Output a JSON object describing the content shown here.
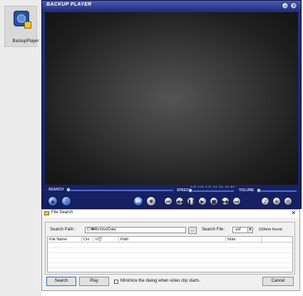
{
  "desktop": {
    "icon_label": "BackupPlayer"
  },
  "player": {
    "title": "BACKUP PLAYER",
    "minimize_glyph": "–",
    "close_glyph": "✕",
    "search_label": "SEARCH",
    "speed_label": "SPEED",
    "volume_label": "VOLUME",
    "speed_ticks": "1/8 1/4 1/2 1x 2x 4x 8x",
    "w_glyph": "W",
    "colors": {
      "frame": "#1e2b72",
      "accent": "#4f7bdc"
    },
    "icons": [
      "eject-icon",
      "search-icon",
      "web-icon",
      "snapshot-icon",
      "skip-back-icon",
      "step-back-icon",
      "pause-icon",
      "play-icon",
      "stop-icon",
      "step-forward-icon",
      "skip-forward-icon",
      "audio-icon",
      "zoom-icon",
      "settings-icon"
    ]
  },
  "dialog": {
    "title": "File Search",
    "close_glyph": "✕",
    "search_path_label": "Search Path :",
    "search_path_value": "C:₩ArchiveData",
    "browse_label": "...",
    "search_file_label": "Search File :",
    "search_file_value": ".ssf",
    "found_count": "(0)Item found",
    "columns": [
      "File Name",
      "CH",
      "시간",
      "Path",
      "Note"
    ],
    "search_button": "Search",
    "play_button": "Play",
    "minimize_checkbox_label": "Minimize the dialog when video clip starts.",
    "minimize_checked": false,
    "cancel_button": "Cancel"
  }
}
